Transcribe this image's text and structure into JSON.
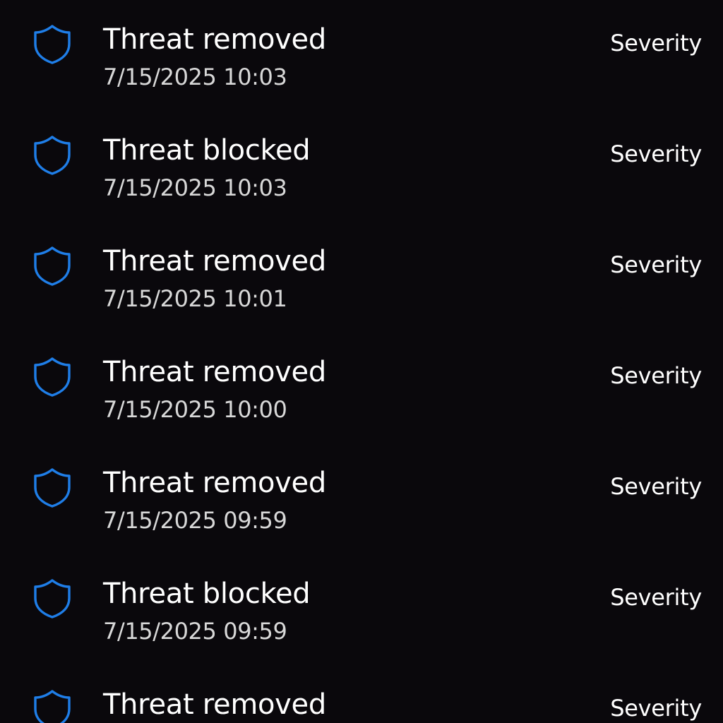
{
  "protection_history": {
    "accent_color": "#1f7ee8",
    "items": [
      {
        "icon": "shield-icon",
        "title": "Threat removed",
        "timestamp": "7/15/2025 10:03",
        "severity_label": "Severity"
      },
      {
        "icon": "shield-icon",
        "title": "Threat blocked",
        "timestamp": "7/15/2025 10:03",
        "severity_label": "Severity"
      },
      {
        "icon": "shield-icon",
        "title": "Threat removed",
        "timestamp": "7/15/2025 10:01",
        "severity_label": "Severity"
      },
      {
        "icon": "shield-icon",
        "title": "Threat removed",
        "timestamp": "7/15/2025 10:00",
        "severity_label": "Severity"
      },
      {
        "icon": "shield-icon",
        "title": "Threat removed",
        "timestamp": "7/15/2025 09:59",
        "severity_label": "Severity"
      },
      {
        "icon": "shield-icon",
        "title": "Threat blocked",
        "timestamp": "7/15/2025 09:59",
        "severity_label": "Severity"
      },
      {
        "icon": "shield-icon",
        "title": "Threat removed",
        "timestamp": "",
        "severity_label": "Severity"
      }
    ]
  }
}
